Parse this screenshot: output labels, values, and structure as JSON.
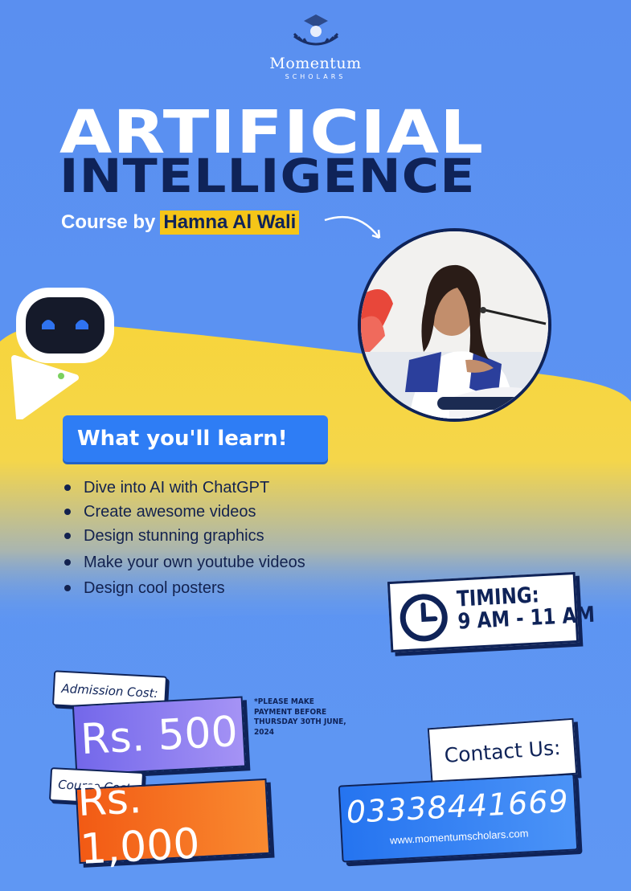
{
  "brand": {
    "name": "Momentum",
    "sub": "SCHOLARS"
  },
  "title": {
    "line1": "ARTIFICIAL",
    "line2": "INTELLIGENCE"
  },
  "byline": {
    "prefix": "Course by",
    "instructor": "Hamna Al Wali"
  },
  "learn": {
    "heading": "What you'll learn!",
    "items": [
      "Dive into AI with ChatGPT",
      "Create awesome videos",
      "Design stunning graphics",
      "Make your own youtube videos",
      "Design cool posters"
    ]
  },
  "timing": {
    "label": "TIMING:",
    "value": "9 AM - 11 AM"
  },
  "admission": {
    "label": "Admission Cost:",
    "price": "Rs. 500"
  },
  "note": "*PLEASE MAKE PAYMENT BEFORE THURSDAY 30TH JUNE, 2024",
  "course": {
    "label": "Course Cost:",
    "price": "Rs. 1,000"
  },
  "contact": {
    "label": "Contact Us:",
    "phone": "03338441669",
    "website": "www.momentumscholars.com"
  },
  "colors": {
    "background": "#5b92f2",
    "yellow_wave": "#f7d33a",
    "navy": "#0f2358",
    "highlight": "#f5c518",
    "orange": "#f25a14",
    "purple": "#7367ea",
    "accent_blue": "#2e7df5"
  },
  "icons": [
    "graduation-cap-laurel-icon",
    "robot-icon",
    "clock-icon",
    "curved-arrow-icon",
    "bullet-icon"
  ]
}
